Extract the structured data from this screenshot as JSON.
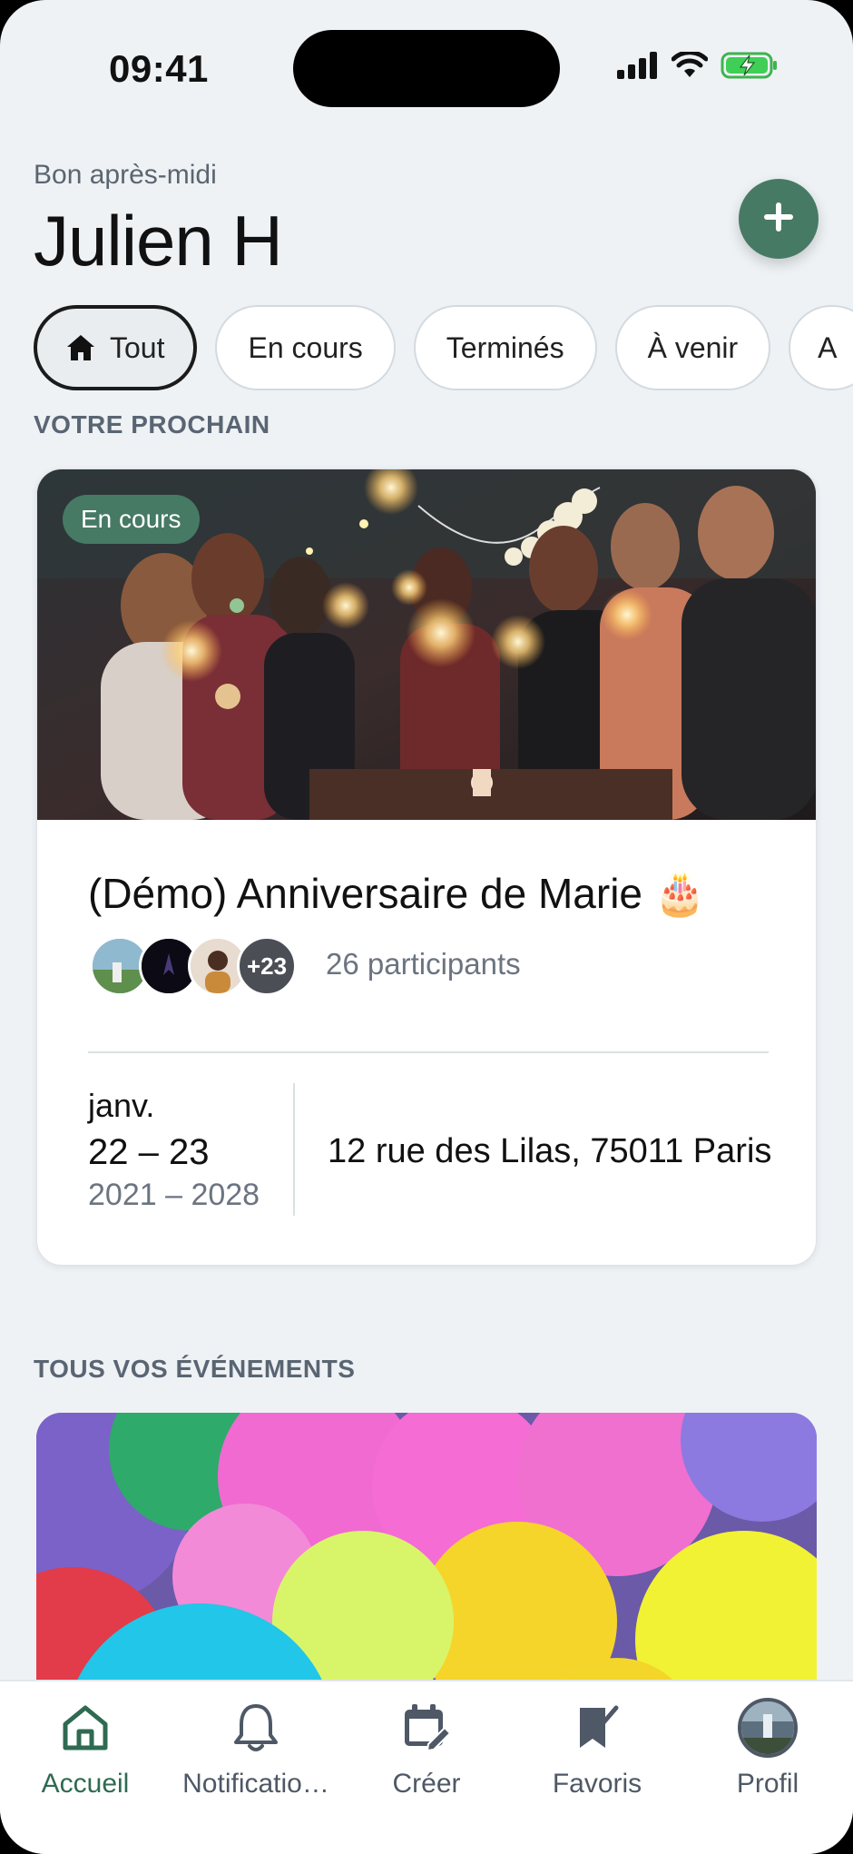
{
  "status_bar": {
    "time": "09:41"
  },
  "header": {
    "greeting": "Bon après-midi",
    "user_name": "Julien H"
  },
  "filters": [
    {
      "label": "Tout",
      "active": true
    },
    {
      "label": "En cours",
      "active": false
    },
    {
      "label": "Terminés",
      "active": false
    },
    {
      "label": "À venir",
      "active": false
    },
    {
      "label": "A",
      "active": false
    }
  ],
  "sections": {
    "next": "VOTRE PROCHAIN",
    "all": "TOUS VOS ÉVÉNEMENTS"
  },
  "featured_event": {
    "badge": "En cours",
    "title": "(Démo) Anniversaire de Marie 🎂",
    "extra_participants": "+23",
    "participants": "26 participants",
    "date_month": "janv.",
    "date_days": "22 – 23",
    "date_years": "2021 – 2028",
    "address": "12 rue des Lilas, 75011 Paris"
  },
  "tabbar": [
    {
      "label": "Accueil",
      "icon": "home-icon",
      "active": true
    },
    {
      "label": "Notificatio…",
      "icon": "bell-icon",
      "active": false
    },
    {
      "label": "Créer",
      "icon": "calendar-edit-icon",
      "active": false
    },
    {
      "label": "Favoris",
      "icon": "bookmark-check-icon",
      "active": false
    },
    {
      "label": "Profil",
      "icon": "avatar",
      "active": false
    }
  ],
  "colors": {
    "accent": "#467a64",
    "background": "#eef2f5",
    "text": "#111111",
    "muted": "#6b7480"
  }
}
